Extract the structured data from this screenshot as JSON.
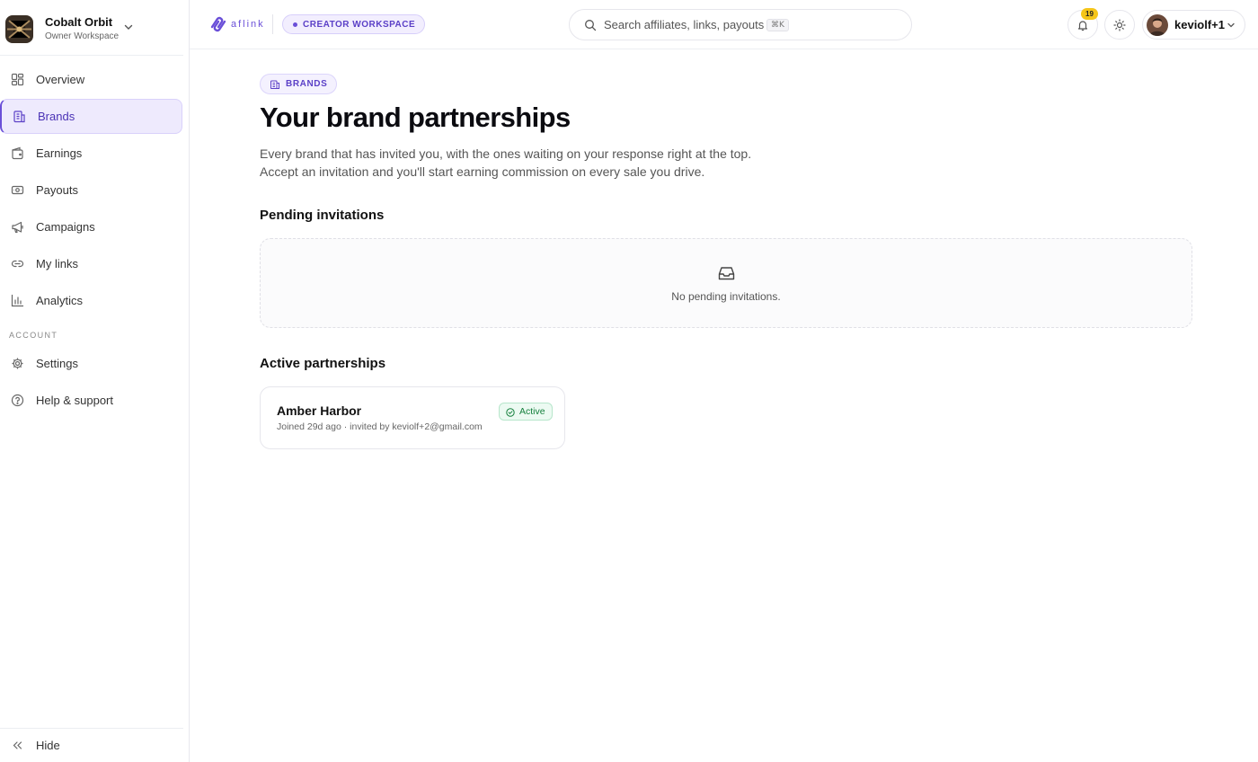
{
  "sidebar": {
    "workspace": {
      "name": "Cobalt Orbit",
      "subtitle": "Owner Workspace"
    },
    "items": [
      {
        "label": "Overview",
        "icon": "grid-icon",
        "active": false
      },
      {
        "label": "Brands",
        "icon": "building-icon",
        "active": true
      },
      {
        "label": "Earnings",
        "icon": "wallet-icon",
        "active": false
      },
      {
        "label": "Payouts",
        "icon": "cash-icon",
        "active": false
      },
      {
        "label": "Campaigns",
        "icon": "megaphone-icon",
        "active": false
      },
      {
        "label": "My links",
        "icon": "link-icon",
        "active": false
      },
      {
        "label": "Analytics",
        "icon": "bar-chart-icon",
        "active": false
      }
    ],
    "account_section": "ACCOUNT",
    "account_items": [
      {
        "label": "Settings",
        "icon": "gear-icon"
      },
      {
        "label": "Help & support",
        "icon": "help-circle-icon"
      }
    ],
    "hide_label": "Hide"
  },
  "topbar": {
    "logo_text": "aflink",
    "workspace_pill": "CREATOR WORKSPACE",
    "search_placeholder": "Search affiliates, links, payouts...",
    "search_shortcut": "⌘K",
    "notification_count": "19",
    "user_name": "keviolf+1"
  },
  "main": {
    "badge": "BRANDS",
    "title": "Your brand partnerships",
    "description_line1": "Every brand that has invited you, with the ones waiting on your response right at the top.",
    "description_line2": "Accept an invitation and you'll start earning commission on every sale you drive.",
    "pending_title": "Pending invitations",
    "pending_empty": "No pending invitations.",
    "active_title": "Active partnerships",
    "partnerships": [
      {
        "name": "Amber Harbor",
        "meta": "Joined 29d ago · invited by keviolf+2@gmail.com",
        "status": "Active"
      }
    ]
  },
  "colors": {
    "accent": "#6a4fd8",
    "active_green": "#15803d",
    "badge_yellow": "#f5c518"
  }
}
